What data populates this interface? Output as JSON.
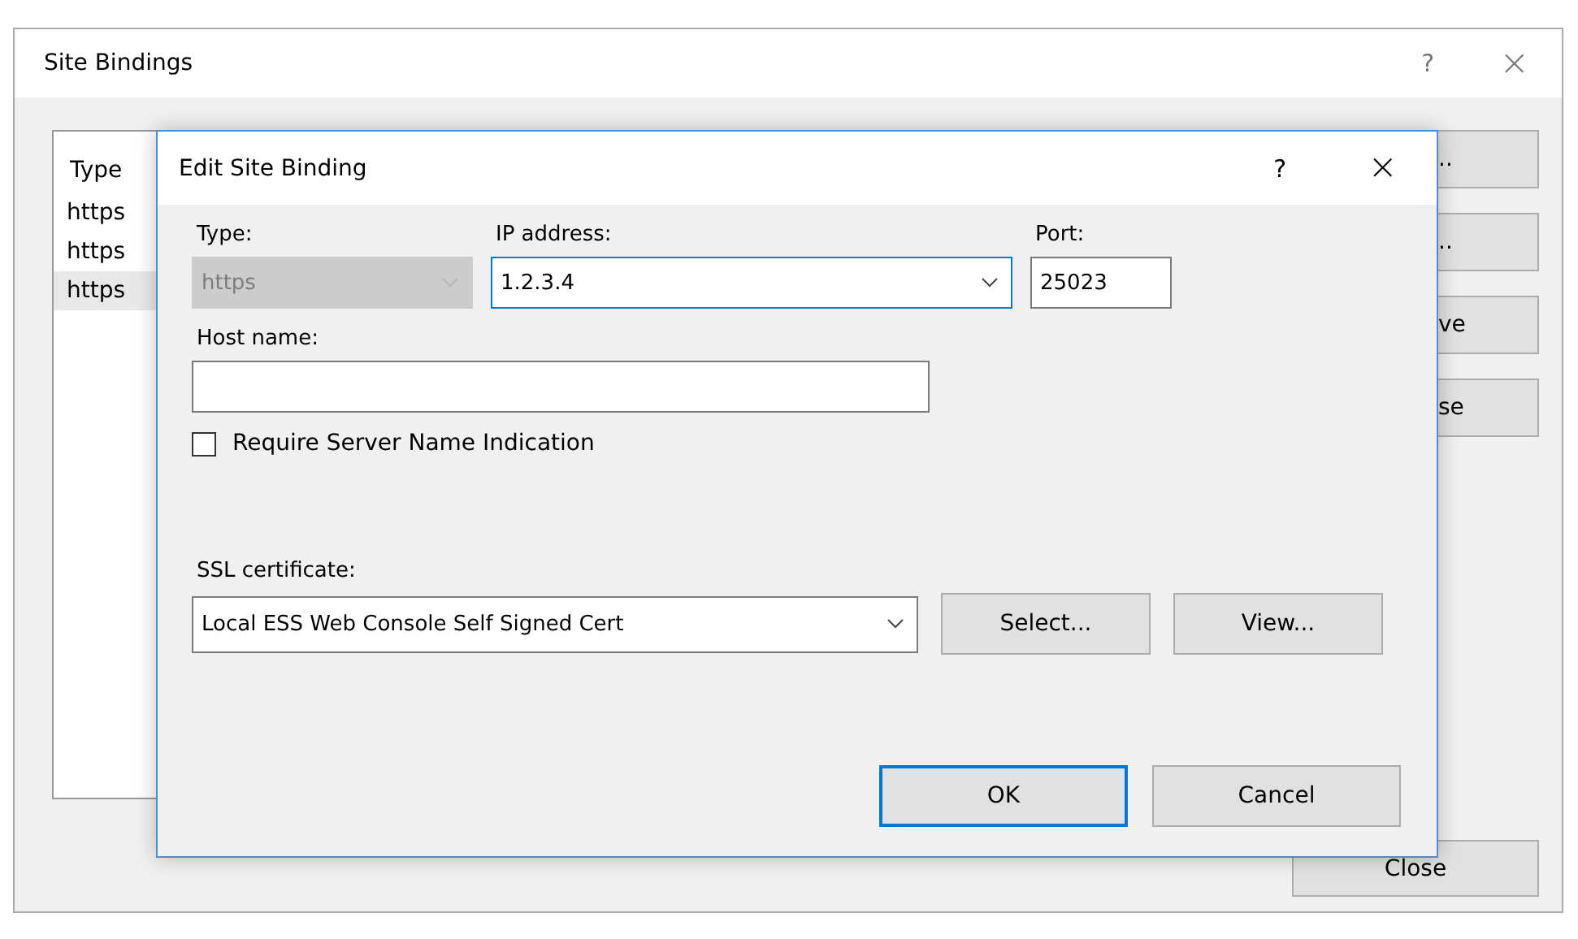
{
  "background_window": {
    "title": "Site Bindings",
    "help": "?",
    "close": "×",
    "list": {
      "columns": [
        "Type"
      ],
      "rows": [
        {
          "type": "https",
          "selected": false
        },
        {
          "type": "https",
          "selected": false
        },
        {
          "type": "https",
          "selected": true
        }
      ]
    },
    "side_buttons": [
      "..",
      "..",
      "ve",
      "se"
    ],
    "close_button": "Close"
  },
  "dialog": {
    "title": "Edit Site Binding",
    "help": "?",
    "close": "×",
    "type": {
      "label": "Type:",
      "value": "https",
      "disabled": true
    },
    "ip_address": {
      "label": "IP address:",
      "value": "1.2.3.4",
      "focused": true
    },
    "port": {
      "label": "Port:",
      "value": "25023"
    },
    "host_name": {
      "label": "Host name:"
    },
    "sni": {
      "label": "Require Server Name Indication",
      "checked": false
    },
    "ssl_certificate": {
      "label": "SSL certificate:",
      "value": "Local ESS Web Console Self Signed Cert"
    },
    "certificate_buttons": [
      "Select...",
      "View..."
    ],
    "buttons": [
      {
        "label": "OK",
        "default": true
      },
      {
        "label": "Cancel",
        "default": false
      }
    ]
  }
}
